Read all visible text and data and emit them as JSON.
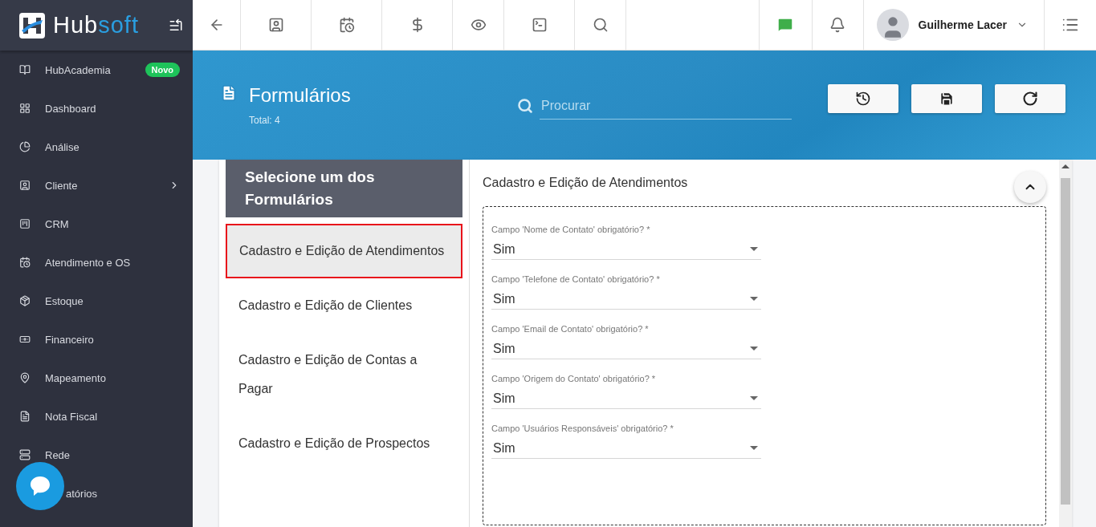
{
  "brand": {
    "name_part1": "Hub",
    "name_part2": "soft"
  },
  "sidebar": {
    "items": [
      {
        "label": "HubAcademia",
        "badge": "Novo",
        "has_submenu": false
      },
      {
        "label": "Dashboard",
        "has_submenu": false
      },
      {
        "label": "Análise",
        "has_submenu": false
      },
      {
        "label": "Cliente",
        "has_submenu": true
      },
      {
        "label": "CRM",
        "has_submenu": false
      },
      {
        "label": "Atendimento e OS",
        "has_submenu": false
      },
      {
        "label": "Estoque",
        "has_submenu": false
      },
      {
        "label": "Financeiro",
        "has_submenu": false
      },
      {
        "label": "Mapeamento",
        "has_submenu": false
      },
      {
        "label": "Nota Fiscal",
        "has_submenu": false
      },
      {
        "label": "Rede",
        "has_submenu": false
      },
      {
        "label": "atórios",
        "has_submenu": false
      }
    ]
  },
  "user": {
    "name": "Guilherme Lacer"
  },
  "page": {
    "title": "Formulários",
    "total": "Total: 4",
    "search_placeholder": "Procurar"
  },
  "forms_list": {
    "heading": "Selecione um dos Formulários",
    "items": [
      {
        "label": "Cadastro e Edição de Atendimentos",
        "selected": true
      },
      {
        "label": "Cadastro e Edição de Clientes",
        "selected": false
      },
      {
        "label": "Cadastro e Edição de Contas a Pagar",
        "selected": false
      },
      {
        "label": "Cadastro e Edição de Prospectos",
        "selected": false
      }
    ]
  },
  "form": {
    "title": "Cadastro e Edição de Atendimentos",
    "expanded": true,
    "fields": [
      {
        "label": "Campo 'Nome de Contato' obrigatório? *",
        "value": "Sim"
      },
      {
        "label": "Campo 'Telefone de Contato' obrigatório? *",
        "value": "Sim"
      },
      {
        "label": "Campo 'Email de Contato' obrigatório? *",
        "value": "Sim"
      },
      {
        "label": "Campo 'Origem do Contato' obrigatório? *",
        "value": "Sim"
      },
      {
        "label": "Campo 'Usuários Responsáveis' obrigatório? *",
        "value": "Sim"
      }
    ]
  }
}
